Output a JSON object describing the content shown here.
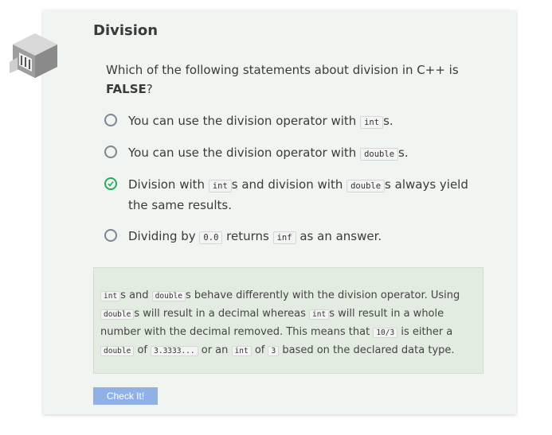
{
  "title": "Division",
  "question": {
    "text": "Which of the following statements about division in C++ is",
    "emphasis": "FALSE",
    "suffix": "?"
  },
  "options": [
    {
      "selected": false,
      "parts": [
        "You can use the division operator with ",
        "int",
        "s."
      ]
    },
    {
      "selected": false,
      "parts": [
        "You can use the division operator with ",
        "double",
        "s."
      ]
    },
    {
      "selected": true,
      "parts": [
        "Division with ",
        "int",
        "s and division with ",
        "double",
        "s always yield the same results."
      ]
    },
    {
      "selected": false,
      "parts": [
        "Dividing by ",
        "0.0",
        " returns ",
        "inf",
        " as an answer."
      ]
    }
  ],
  "feedback": {
    "parts": [
      "int",
      "s and ",
      "double",
      "s behave differently with the division operator. Using ",
      "double",
      "s will result in a decimal whereas ",
      "int",
      "s will result in a whole number with the decimal removed. This means that ",
      "10/3",
      " is either a ",
      "double",
      " of ",
      "3.3333...",
      " or an ",
      "int",
      " of ",
      "3",
      " based on the declared data type."
    ]
  },
  "check_button": "Check It!",
  "colors": {
    "card_bg": "#f1f5f1",
    "feedback_bg": "#e3ece1",
    "correct_green": "#27a85b",
    "button_blue": "#8fb1e8"
  },
  "icons": {
    "logo": "codio-cube-logo",
    "selected_radio": "check-circle-icon"
  }
}
